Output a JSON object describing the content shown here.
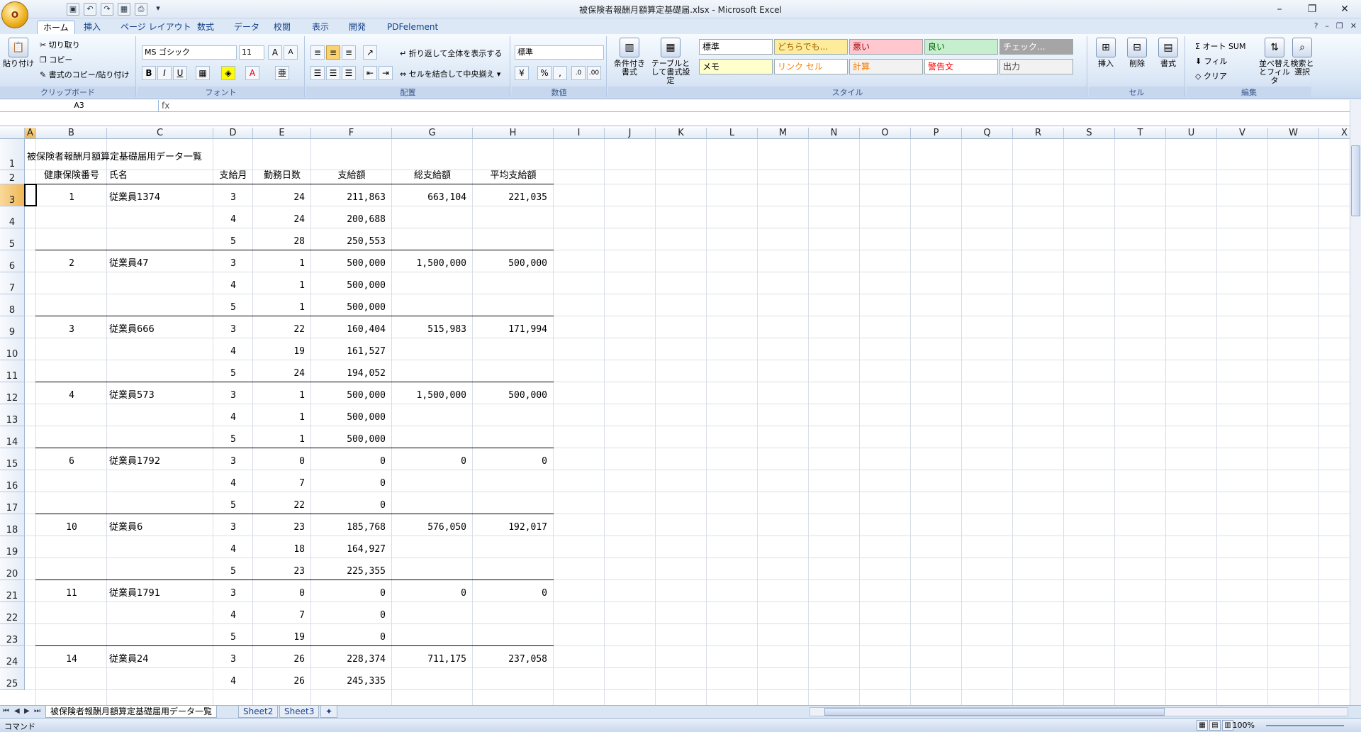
{
  "title": "被保険者報酬月額算定基礎届.xlsx - Microsoft Excel",
  "office_button": "O",
  "window_controls": [
    "–",
    "❐",
    "✕"
  ],
  "tabs": [
    "ホーム",
    "挿入",
    "ページ レイアウト",
    "数式",
    "データ",
    "校閲",
    "表示",
    "開発",
    "PDFelement"
  ],
  "ribbon": {
    "clipboard": {
      "paste": "貼り付け",
      "cut": "切り取り",
      "copy": "コピー",
      "format_painter": "書式のコピー/貼り付け",
      "label": "クリップボード"
    },
    "font": {
      "name": "MS ゴシック",
      "size": "11",
      "label": "フォント",
      "bold": "B",
      "italic": "I",
      "underline": "U"
    },
    "alignment": {
      "wrap": "折り返して全体を表示する",
      "merge": "セルを結合して中央揃え",
      "label": "配置"
    },
    "number": {
      "format": "標準",
      "label": "数値",
      "percent": "%",
      "comma": ","
    },
    "styles": {
      "conditional": "条件付き書式",
      "table": "テーブルとして書式設定",
      "cells": [
        {
          "name": "標準",
          "bg": "#ffffff",
          "fg": "#000000"
        },
        {
          "name": "どちらでも...",
          "bg": "#ffeb9c",
          "fg": "#9c6500"
        },
        {
          "name": "悪い",
          "bg": "#ffc7ce",
          "fg": "#9c0006"
        },
        {
          "name": "良い",
          "bg": "#c6efce",
          "fg": "#006100"
        },
        {
          "name": "チェック...",
          "bg": "#a5a5a5",
          "fg": "#ffffff"
        },
        {
          "name": "メモ",
          "bg": "#ffffcc",
          "fg": "#000000"
        },
        {
          "name": "リンク セル",
          "bg": "#ffffff",
          "fg": "#fa7d00"
        },
        {
          "name": "計算",
          "bg": "#f2f2f2",
          "fg": "#fa7d00"
        },
        {
          "name": "警告文",
          "bg": "#ffffff",
          "fg": "#ff0000"
        },
        {
          "name": "出力",
          "bg": "#f2f2f2",
          "fg": "#3f3f3f"
        }
      ],
      "label": "スタイル"
    },
    "cells": {
      "insert": "挿入",
      "delete": "削除",
      "format": "書式",
      "label": "セル"
    },
    "editing": {
      "autosum": "オート SUM",
      "fill": "フィル",
      "clear": "クリア",
      "sort": "並べ替えとフィルタ",
      "find": "検索と選択",
      "label": "編集"
    }
  },
  "formula_bar": {
    "name_box": "A3",
    "fx": "fx",
    "content": ""
  },
  "columns": [
    "A",
    "B",
    "C",
    "D",
    "E",
    "F",
    "G",
    "H",
    "I",
    "J",
    "K",
    "L",
    "M",
    "N",
    "O",
    "P",
    "Q",
    "R",
    "S",
    "T",
    "U",
    "V",
    "W",
    "X"
  ],
  "rows": [
    "1",
    "2",
    "3",
    "4",
    "5",
    "6",
    "7",
    "8",
    "9",
    "10",
    "11",
    "12",
    "13",
    "14",
    "15",
    "16",
    "17",
    "18",
    "19",
    "20",
    "21",
    "22",
    "23",
    "24",
    "25"
  ],
  "sheet": {
    "heading": "被保険者報酬月額算定基礎届用データ一覧",
    "headers": [
      "健康保険番号",
      "氏名",
      "支給月",
      "勤務日数",
      "支給額",
      "総支給額",
      "平均支給額"
    ],
    "rows": [
      {
        "no": "1",
        "name": "従業員1374",
        "month": "3",
        "days": "24",
        "pay": "211,863",
        "total": "663,104",
        "avg": "221,035"
      },
      {
        "no": "",
        "name": "",
        "month": "4",
        "days": "24",
        "pay": "200,688",
        "total": "",
        "avg": ""
      },
      {
        "no": "",
        "name": "",
        "month": "5",
        "days": "28",
        "pay": "250,553",
        "total": "",
        "avg": ""
      },
      {
        "no": "2",
        "name": "従業員47",
        "month": "3",
        "days": "1",
        "pay": "500,000",
        "total": "1,500,000",
        "avg": "500,000"
      },
      {
        "no": "",
        "name": "",
        "month": "4",
        "days": "1",
        "pay": "500,000",
        "total": "",
        "avg": ""
      },
      {
        "no": "",
        "name": "",
        "month": "5",
        "days": "1",
        "pay": "500,000",
        "total": "",
        "avg": ""
      },
      {
        "no": "3",
        "name": "従業員666",
        "month": "3",
        "days": "22",
        "pay": "160,404",
        "total": "515,983",
        "avg": "171,994"
      },
      {
        "no": "",
        "name": "",
        "month": "4",
        "days": "19",
        "pay": "161,527",
        "total": "",
        "avg": ""
      },
      {
        "no": "",
        "name": "",
        "month": "5",
        "days": "24",
        "pay": "194,052",
        "total": "",
        "avg": ""
      },
      {
        "no": "4",
        "name": "従業員573",
        "month": "3",
        "days": "1",
        "pay": "500,000",
        "total": "1,500,000",
        "avg": "500,000"
      },
      {
        "no": "",
        "name": "",
        "month": "4",
        "days": "1",
        "pay": "500,000",
        "total": "",
        "avg": ""
      },
      {
        "no": "",
        "name": "",
        "month": "5",
        "days": "1",
        "pay": "500,000",
        "total": "",
        "avg": ""
      },
      {
        "no": "6",
        "name": "従業員1792",
        "month": "3",
        "days": "0",
        "pay": "0",
        "total": "0",
        "avg": "0"
      },
      {
        "no": "",
        "name": "",
        "month": "4",
        "days": "7",
        "pay": "0",
        "total": "",
        "avg": ""
      },
      {
        "no": "",
        "name": "",
        "month": "5",
        "days": "22",
        "pay": "0",
        "total": "",
        "avg": ""
      },
      {
        "no": "10",
        "name": "従業員6",
        "month": "3",
        "days": "23",
        "pay": "185,768",
        "total": "576,050",
        "avg": "192,017"
      },
      {
        "no": "",
        "name": "",
        "month": "4",
        "days": "18",
        "pay": "164,927",
        "total": "",
        "avg": ""
      },
      {
        "no": "",
        "name": "",
        "month": "5",
        "days": "23",
        "pay": "225,355",
        "total": "",
        "avg": ""
      },
      {
        "no": "11",
        "name": "従業員1791",
        "month": "3",
        "days": "0",
        "pay": "0",
        "total": "0",
        "avg": "0"
      },
      {
        "no": "",
        "name": "",
        "month": "4",
        "days": "7",
        "pay": "0",
        "total": "",
        "avg": ""
      },
      {
        "no": "",
        "name": "",
        "month": "5",
        "days": "19",
        "pay": "0",
        "total": "",
        "avg": ""
      },
      {
        "no": "14",
        "name": "従業員24",
        "month": "3",
        "days": "26",
        "pay": "228,374",
        "total": "711,175",
        "avg": "237,058"
      },
      {
        "no": "",
        "name": "",
        "month": "4",
        "days": "26",
        "pay": "245,335",
        "total": "",
        "avg": ""
      }
    ]
  },
  "sheet_tabs": [
    "被保険者報酬月額算定基礎届用データ一覧",
    "Sheet2",
    "Sheet3"
  ],
  "status": {
    "mode": "コマンド",
    "zoom": "100%"
  }
}
